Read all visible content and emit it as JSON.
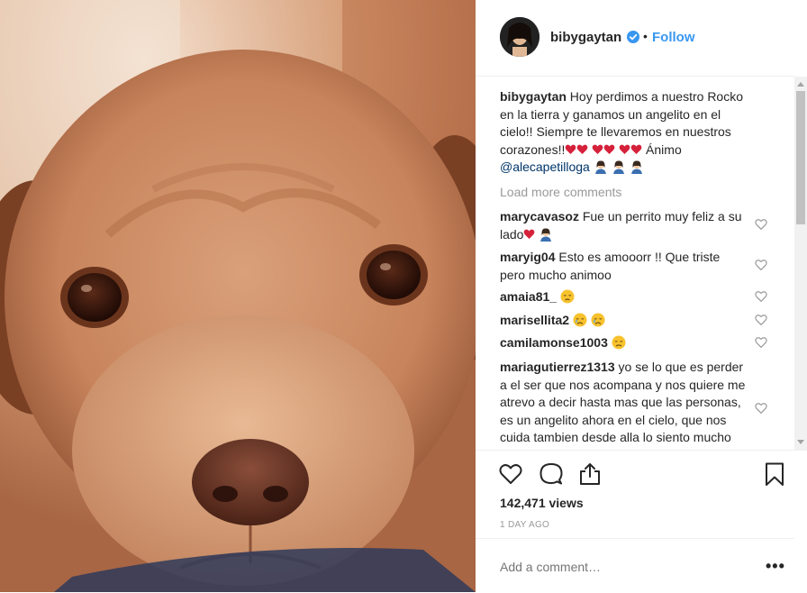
{
  "post": {
    "author": "bibygaytan",
    "follow_label": "Follow",
    "separator": "•",
    "image_subject": "puppy-closeup-photo"
  },
  "caption": {
    "user": "bibygaytan",
    "text_main": "Hoy perdimos a nuestro Rocko en la tierra y ganamos un angelito en el cielo!! Siempre te llevaremos en nuestros corazones!!",
    "text_after": "Ánimo",
    "mention": "@alecapetilloga"
  },
  "load_more_label": "Load more comments",
  "comments": [
    {
      "user": "marycavasoz",
      "text": "Fue un perrito muy feliz a su lado"
    },
    {
      "user": "maryig04",
      "text": "Esto es amooorr !! Que triste pero mucho animoo"
    },
    {
      "user": "amaia81_",
      "text": ""
    },
    {
      "user": "marisellita2",
      "text": ""
    },
    {
      "user": "camilamonse1003",
      "text": ""
    },
    {
      "user": "mariagutierrez1313",
      "text": "yo se lo que es perder a el ser que nos acompana y nos quiere me atrevo a decir hasta mas que las personas, es un angelito ahora en el cielo, que nos cuida tambien desde alla lo siento mucho"
    }
  ],
  "stats": {
    "views": "142,471 views",
    "time": "1 DAY AGO"
  },
  "add_comment": {
    "placeholder": "Add a comment…",
    "more_label": "•••"
  },
  "icons": [
    "verified-icon",
    "heart-icon",
    "comment-icon",
    "share-icon",
    "bookmark-icon",
    "like-comment-heart-icon"
  ],
  "colors": {
    "link_blue": "#3897f0",
    "mention_blue": "#003569",
    "muted": "#999999",
    "text": "#262626",
    "emoji_red": "#d6213b"
  }
}
